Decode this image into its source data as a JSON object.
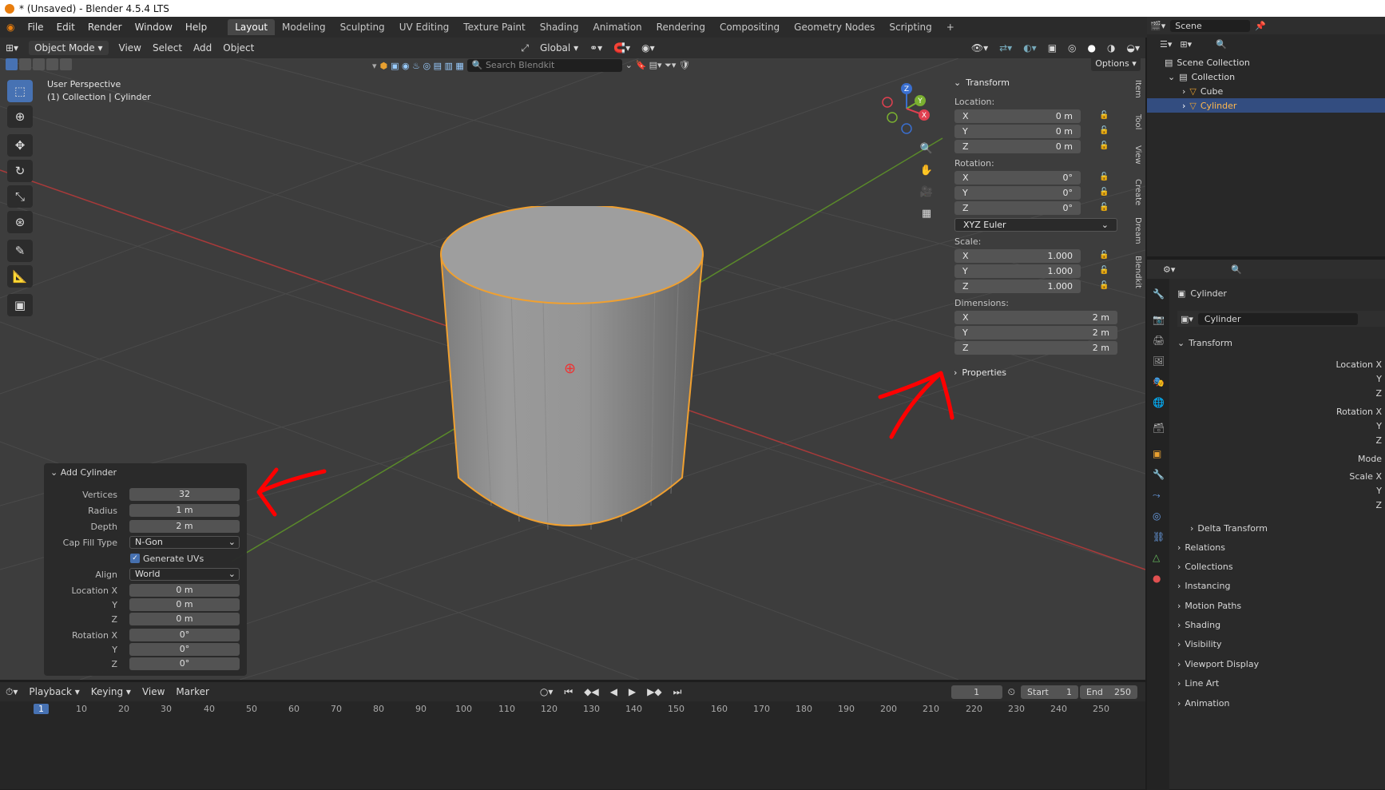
{
  "window": {
    "title": "* (Unsaved) - Blender 4.5.4 LTS"
  },
  "menu": [
    "File",
    "Edit",
    "Render",
    "Window",
    "Help"
  ],
  "workspaces": [
    "Layout",
    "Modeling",
    "Sculpting",
    "UV Editing",
    "Texture Paint",
    "Shading",
    "Animation",
    "Rendering",
    "Compositing",
    "Geometry Nodes",
    "Scripting"
  ],
  "viewport_header": {
    "mode": "Object Mode",
    "menus": [
      "View",
      "Select",
      "Add",
      "Object"
    ],
    "orientation": "Global",
    "options": "Options",
    "search_placeholder": "Search Blendkit"
  },
  "viewport": {
    "perspective": "User Perspective",
    "collection_info": "(1) Collection | Cylinder",
    "gizmo": {
      "z": "Z",
      "y": "Y",
      "x": "X"
    }
  },
  "npanel": {
    "title": "Transform",
    "location_label": "Location:",
    "location": [
      {
        "axis": "X",
        "value": "0 m"
      },
      {
        "axis": "Y",
        "value": "0 m"
      },
      {
        "axis": "Z",
        "value": "0 m"
      }
    ],
    "rotation_label": "Rotation:",
    "rotation": [
      {
        "axis": "X",
        "value": "0°"
      },
      {
        "axis": "Y",
        "value": "0°"
      },
      {
        "axis": "Z",
        "value": "0°"
      }
    ],
    "rotation_mode": "XYZ Euler",
    "scale_label": "Scale:",
    "scale": [
      {
        "axis": "X",
        "value": "1.000"
      },
      {
        "axis": "Y",
        "value": "1.000"
      },
      {
        "axis": "Z",
        "value": "1.000"
      }
    ],
    "dimensions_label": "Dimensions:",
    "dimensions": [
      {
        "axis": "X",
        "value": "2 m"
      },
      {
        "axis": "Y",
        "value": "2 m"
      },
      {
        "axis": "Z",
        "value": "2 m"
      }
    ],
    "properties": "Properties",
    "tabs": [
      "Item",
      "Tool",
      "View",
      "Create",
      "Dream",
      "Blendkit"
    ]
  },
  "redo_panel": {
    "title": "Add Cylinder",
    "vertices_label": "Vertices",
    "vertices": "32",
    "radius_label": "Radius",
    "radius": "1 m",
    "depth_label": "Depth",
    "depth": "2 m",
    "cap_label": "Cap Fill Type",
    "cap": "N-Gon",
    "uv_label": "Generate UVs",
    "align_label": "Align",
    "align": "World",
    "locx_label": "Location X",
    "locx": "0 m",
    "y_label": "Y",
    "locy": "0 m",
    "z_label": "Z",
    "locz": "0 m",
    "rotx_label": "Rotation X",
    "rotx": "0°",
    "roty": "0°",
    "rotz": "0°"
  },
  "timeline": {
    "menus": [
      "Playback",
      "Keying",
      "View",
      "Marker"
    ],
    "current_frame": "1",
    "start_label": "Start",
    "start": "1",
    "end_label": "End",
    "end": "250",
    "ticks": [
      "1",
      "10",
      "20",
      "30",
      "40",
      "50",
      "60",
      "70",
      "80",
      "90",
      "100",
      "110",
      "120",
      "130",
      "140",
      "150",
      "160",
      "170",
      "180",
      "190",
      "200",
      "210",
      "220",
      "230",
      "240",
      "250"
    ]
  },
  "outliner": {
    "scene": "Scene",
    "scene_collection": "Scene Collection",
    "collection": "Collection",
    "items": [
      "Cube",
      "Cylinder"
    ]
  },
  "properties": {
    "object": "Cylinder",
    "data_name": "Cylinder",
    "section": "Transform",
    "rows": [
      "Location X",
      "Y",
      "Z",
      "Rotation X",
      "Y",
      "Z",
      "Mode",
      "Scale X",
      "Y",
      "Z"
    ],
    "delta": "Delta Transform",
    "panels": [
      "Relations",
      "Collections",
      "Instancing",
      "Motion Paths",
      "Shading",
      "Visibility",
      "Viewport Display",
      "Line Art",
      "Animation"
    ]
  },
  "colors": {
    "accent": "#4772b3",
    "selection": "#f0a030",
    "annotation": "#ff0000"
  }
}
